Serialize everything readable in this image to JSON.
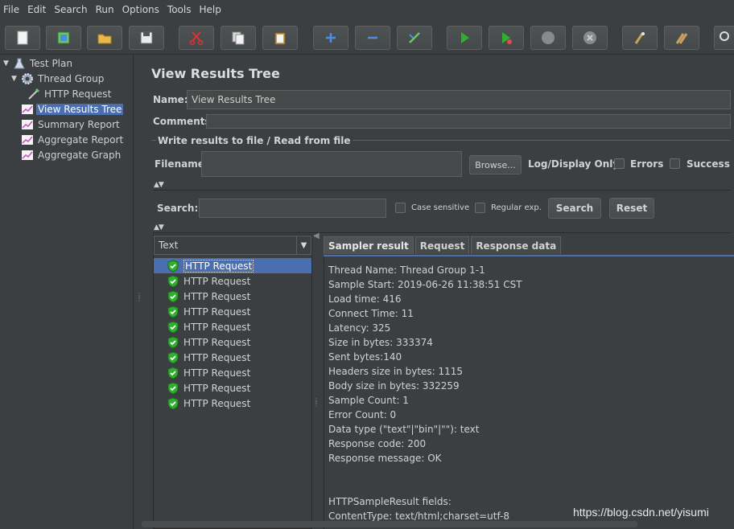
{
  "menu": [
    "File",
    "Edit",
    "Search",
    "Run",
    "Options",
    "Tools",
    "Help"
  ],
  "toolbar_icons": [
    "new-icon",
    "templates-icon",
    "open-icon",
    "save-icon",
    "cut-icon",
    "copy-icon",
    "paste-icon",
    "expand-icon",
    "collapse-icon",
    "toggle-icon",
    "start-icon",
    "start-no-pause-icon",
    "stop-icon",
    "shutdown-icon",
    "clear-icon",
    "clear-all-icon",
    "search-icon"
  ],
  "tree": {
    "items": [
      {
        "label": "Test Plan",
        "icon": "flask-icon"
      },
      {
        "label": "Thread Group",
        "icon": "gear-icon"
      },
      {
        "label": "HTTP Request",
        "icon": "pipette-icon"
      },
      {
        "label": "View Results Tree",
        "icon": "graph-icon"
      },
      {
        "label": "Summary Report",
        "icon": "graph-icon"
      },
      {
        "label": "Aggregate Report",
        "icon": "graph-icon"
      },
      {
        "label": "Aggregate Graph",
        "icon": "graph-icon"
      }
    ]
  },
  "panel": {
    "title": "View Results Tree",
    "name_label": "Name:",
    "name_value": "View Results Tree",
    "comments_label": "Comments:",
    "file_group_title": "Write results to file / Read from file",
    "filename_label": "Filename",
    "filename_value": "",
    "browse_label": "Browse...",
    "log_display_label": "Log/Display Only:",
    "errors_label": "Errors",
    "successes_label": "Success",
    "search_label": "Search:",
    "search_value": "",
    "case_sensitive_label": "Case sensitive",
    "regex_label": "Regular exp.",
    "search_button": "Search",
    "reset_button": "Reset"
  },
  "results": {
    "renderer": "Text",
    "items": [
      "HTTP Request",
      "HTTP Request",
      "HTTP Request",
      "HTTP Request",
      "HTTP Request",
      "HTTP Request",
      "HTTP Request",
      "HTTP Request",
      "HTTP Request",
      "HTTP Request"
    ]
  },
  "tabs": [
    "Sampler result",
    "Request",
    "Response data"
  ],
  "details": [
    "Thread Name: Thread Group 1-1",
    "Sample Start: 2019-06-26 11:38:51 CST",
    "Load time: 416",
    "Connect Time: 11",
    "Latency: 325",
    "Size in bytes: 333374",
    "Sent bytes:140",
    "Headers size in bytes: 1115",
    "Body size in bytes: 332259",
    "Sample Count: 1",
    "Error Count: 0",
    "Data type (\"text\"|\"bin\"|\"\"): text",
    "Response code: 200",
    "Response message: OK",
    "",
    "",
    "HTTPSampleResult fields:",
    "ContentType: text/html;charset=utf-8"
  ],
  "watermark": "https://blog.csdn.net/yisumi",
  "colors": {
    "selection": "#4b6eaf",
    "background": "#3c3f41",
    "success": "#2fae2f"
  }
}
